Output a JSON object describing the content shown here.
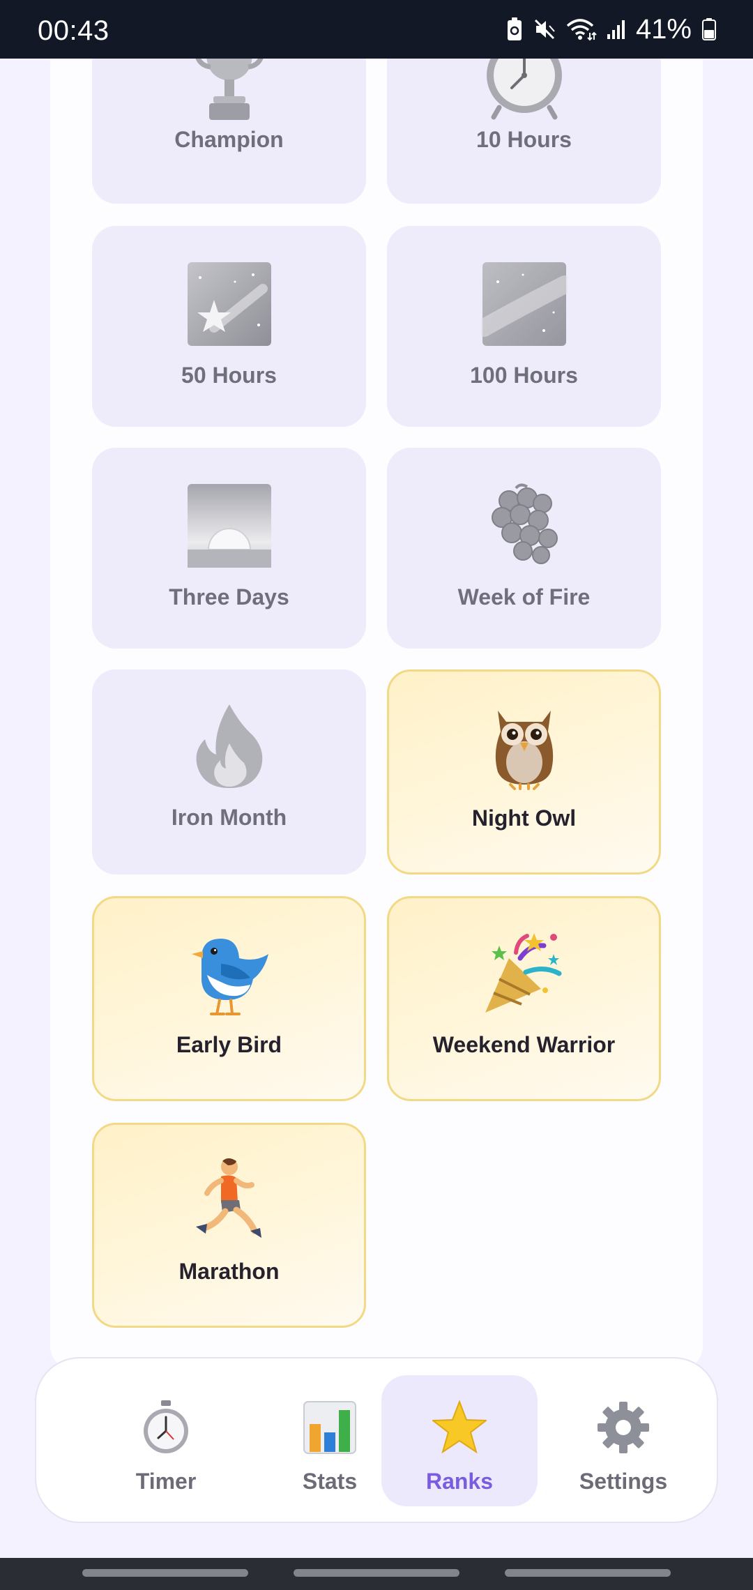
{
  "status_bar": {
    "time": "00:43",
    "battery_percent": "41%"
  },
  "badges": [
    {
      "label": "Champion",
      "icon": "trophy-icon",
      "earned": false
    },
    {
      "label": "10 Hours",
      "icon": "alarm-clock-icon",
      "earned": false
    },
    {
      "label": "50 Hours",
      "icon": "shooting-star-icon",
      "earned": false
    },
    {
      "label": "100 Hours",
      "icon": "milky-way-icon",
      "earned": false
    },
    {
      "label": "Three Days",
      "icon": "sunrise-icon",
      "earned": false
    },
    {
      "label": "Week of Fire",
      "icon": "grapes-icon",
      "earned": false
    },
    {
      "label": "Iron Month",
      "icon": "fire-icon",
      "earned": false
    },
    {
      "label": "Night Owl",
      "icon": "owl-icon",
      "earned": true
    },
    {
      "label": "Early Bird",
      "icon": "bird-icon",
      "earned": true
    },
    {
      "label": "Weekend Warrior",
      "icon": "party-popper-icon",
      "earned": true
    },
    {
      "label": "Marathon",
      "icon": "runner-icon",
      "earned": true
    }
  ],
  "nav": {
    "active": "Ranks",
    "items": [
      {
        "label": "Timer",
        "icon": "stopwatch-icon"
      },
      {
        "label": "Stats",
        "icon": "bar-chart-icon"
      },
      {
        "label": "Ranks",
        "icon": "star-icon"
      },
      {
        "label": "Settings",
        "icon": "gear-icon"
      }
    ]
  },
  "colors": {
    "accent": "#7a5ce0",
    "earned_border": "#f2d985",
    "locked_card": "#eeebfb"
  }
}
